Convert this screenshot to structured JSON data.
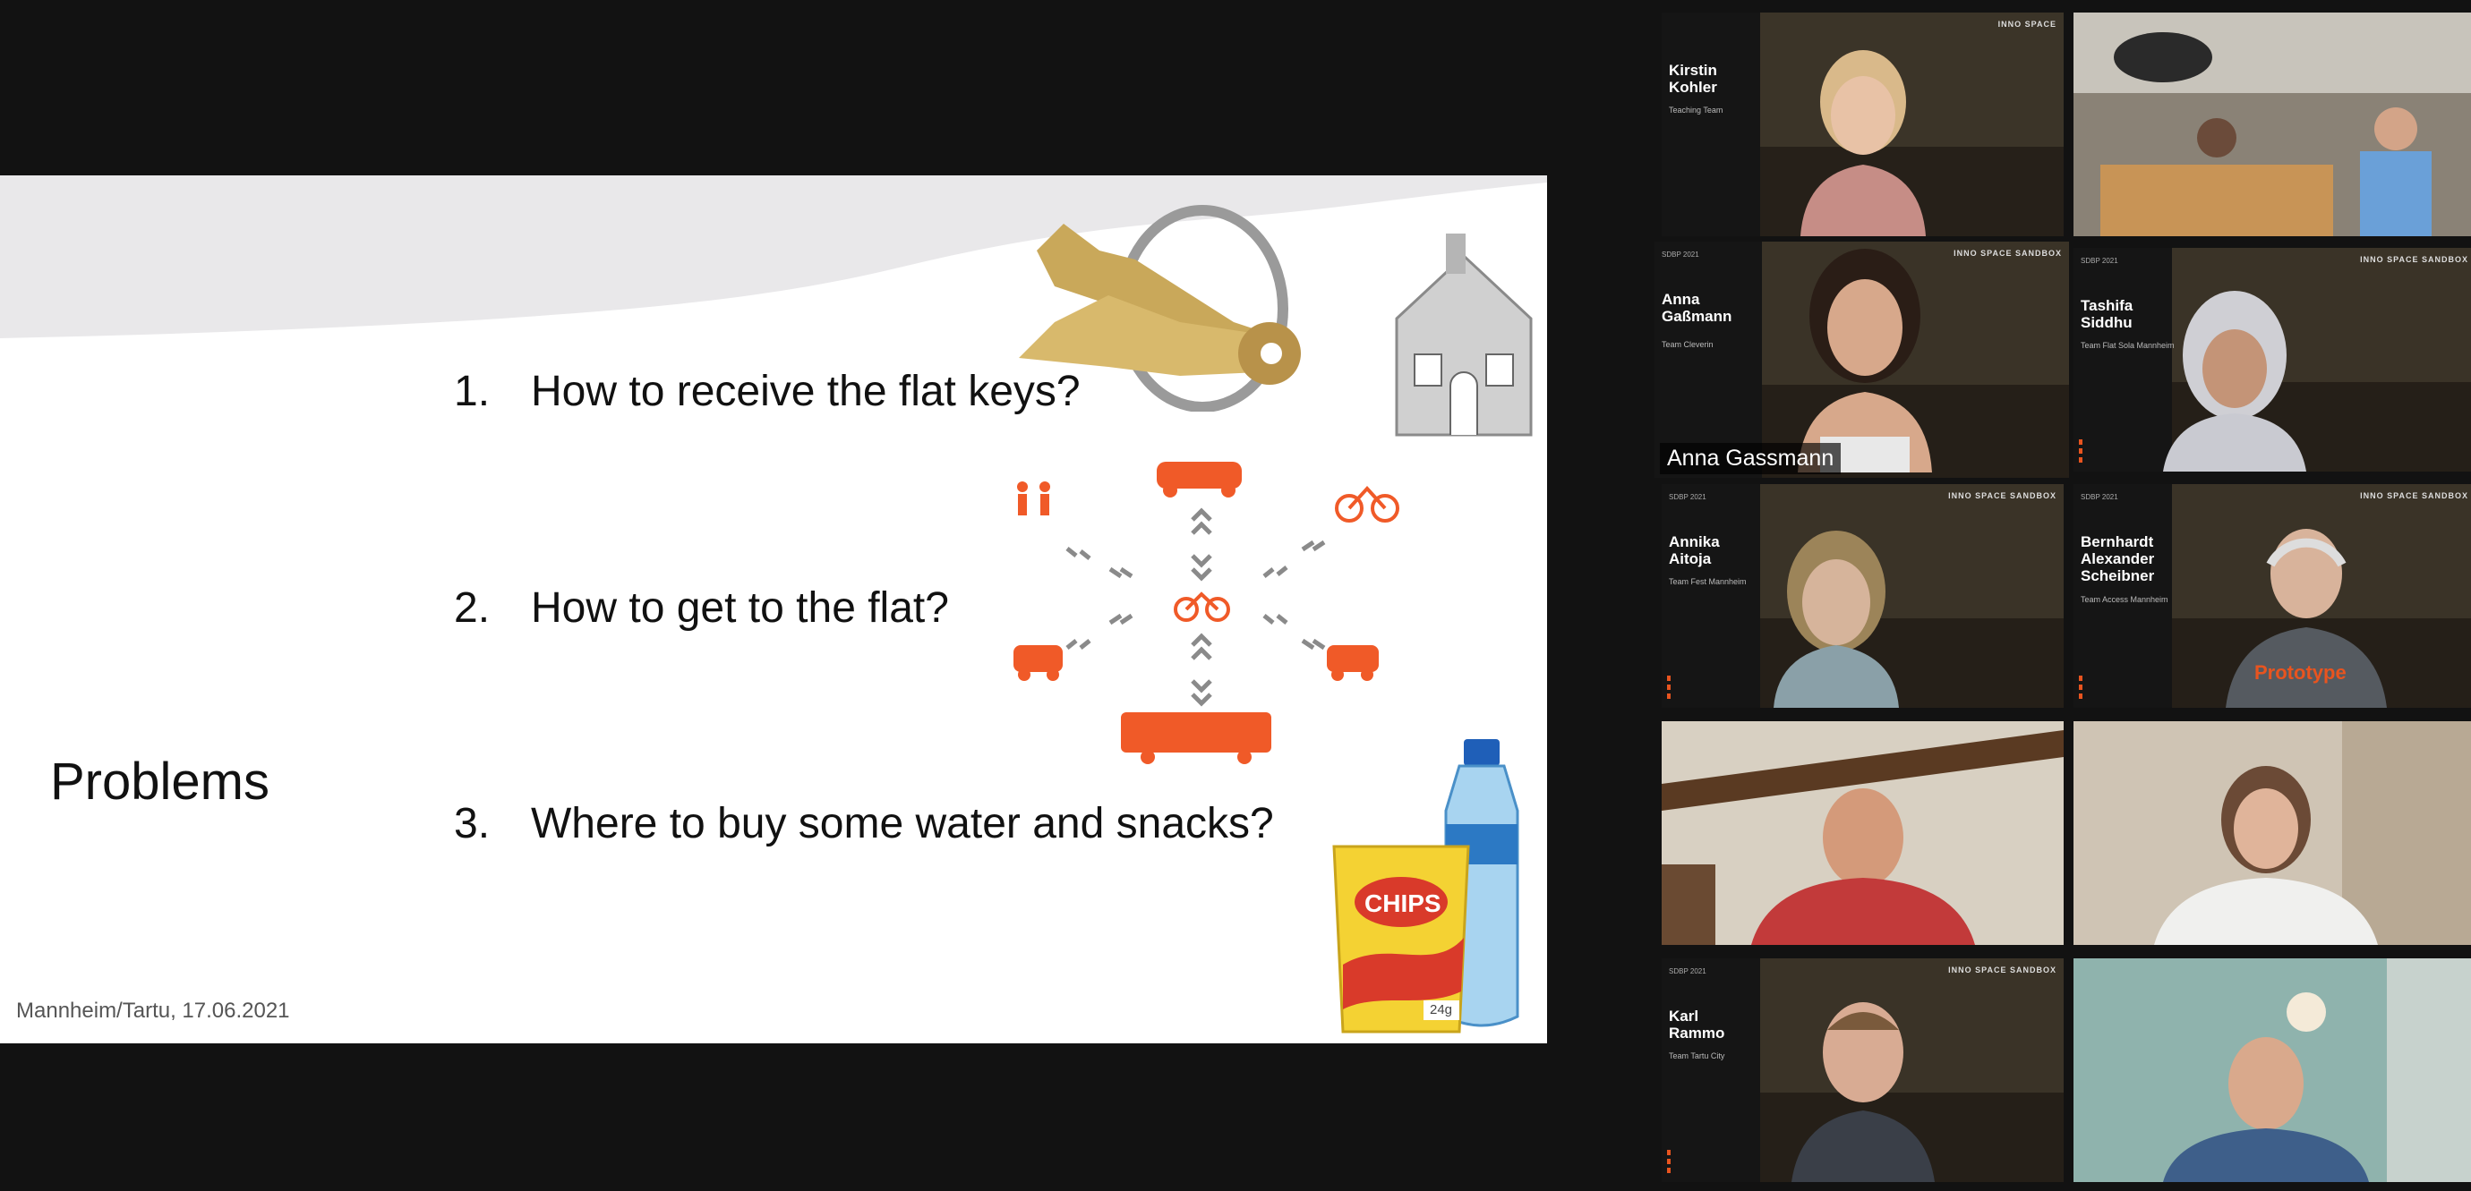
{
  "slide": {
    "title": "Problems",
    "items": [
      {
        "num": "1.",
        "text": "How to receive the flat keys?"
      },
      {
        "num": "2.",
        "text": "How to get to the flat?"
      },
      {
        "num": "3.",
        "text": "Where to buy some water and snacks?"
      }
    ],
    "footer": "Mannheim/Tartu, 17.06.2021",
    "chips_label": "CHIPS",
    "chips_weight": "24g",
    "icons": [
      "keys-icon",
      "house-keychain-icon",
      "car-icon",
      "walking-icon",
      "bicycle-icon",
      "bus-icon",
      "taxi-icon",
      "carsharing-icon",
      "water-bottle-icon",
      "chips-bag-icon"
    ],
    "colors": {
      "accent": "#f05a28",
      "arrow": "#8a8a8a"
    }
  },
  "gallery": {
    "tiles": [
      {
        "overlay_name": "Kirstin Kohler",
        "overlay_role": "Teaching Team",
        "brand": "INNO SPACE"
      },
      {
        "overlay_name": "",
        "overlay_role": "",
        "brand": ""
      },
      {
        "overlay_name": "Anna Gaßmann",
        "overlay_role": "Team Cleverin",
        "brand": "INNO SPACE  SANDBOX",
        "event": "SDBP 2021",
        "label": "Anna Gassmann",
        "active": true
      },
      {
        "overlay_name": "Tashifa Siddhu",
        "overlay_role": "Team Flat Sola Mannheim",
        "brand": "INNO SPACE  SANDBOX",
        "event": "SDBP 2021"
      },
      {
        "overlay_name": "Annika Aitoja",
        "overlay_role": "Team Fest Mannheim",
        "brand": "INNO SPACE  SANDBOX",
        "event": "SDBP 2021"
      },
      {
        "overlay_name": "Bernhardt Alexander Scheibner",
        "overlay_role": "Team Access Mannheim",
        "brand": "INNO SPACE  SANDBOX",
        "event": "SDBP 2021",
        "shirt": "Prototype"
      },
      {
        "overlay_name": "",
        "overlay_role": "",
        "brand": ""
      },
      {
        "overlay_name": "",
        "overlay_role": "",
        "brand": ""
      },
      {
        "overlay_name": "Karl Rammo",
        "overlay_role": "Team Tartu City",
        "brand": "INNO SPACE  SANDBOX",
        "event": "SDBP 2021"
      },
      {
        "overlay_name": "",
        "overlay_role": "",
        "brand": ""
      }
    ]
  }
}
